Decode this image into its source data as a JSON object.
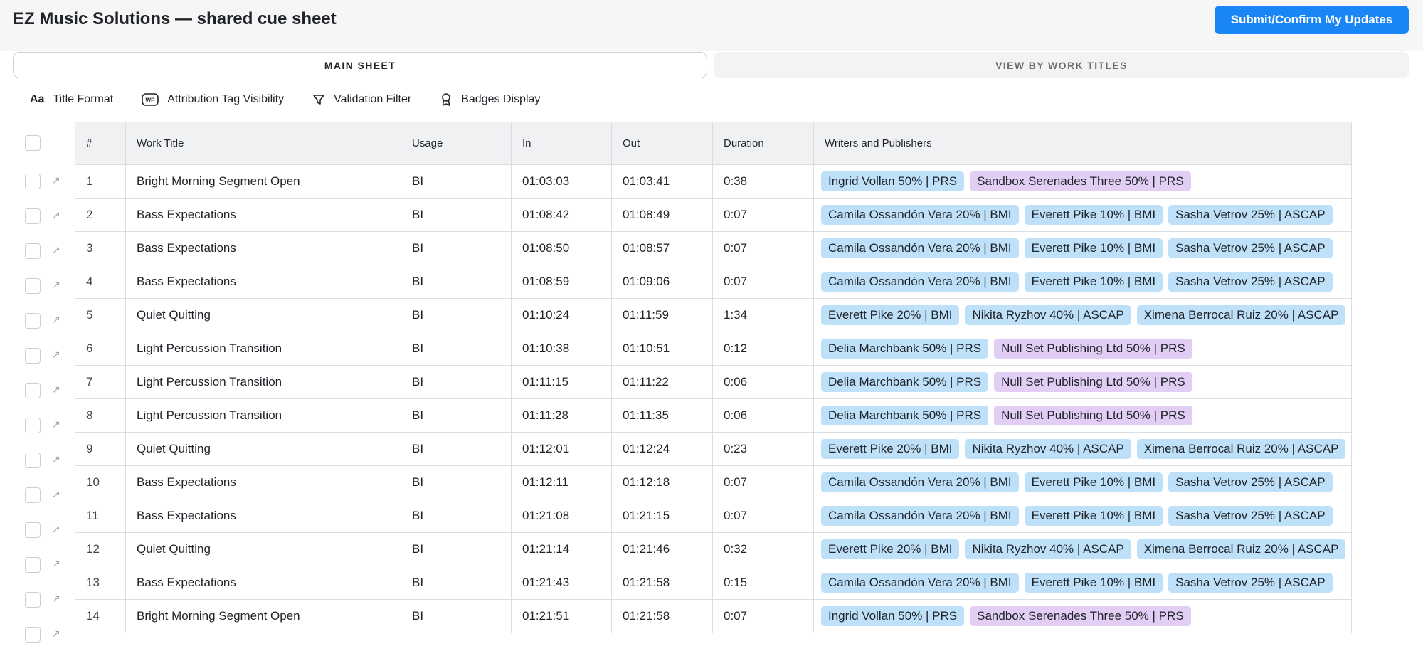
{
  "app": {
    "title": "EZ Music Solutions — shared cue sheet",
    "submit_label": "Submit/Confirm My Updates"
  },
  "tabs": {
    "main": "MAIN SHEET",
    "works": "VIEW BY WORK TITLES"
  },
  "toolbar": {
    "title_format": "Title Format",
    "attribution": "Attribution Tag Visibility",
    "validation": "Validation Filter",
    "badges": "Badges Display"
  },
  "table": {
    "headers": {
      "num": "#",
      "title": "Work Title",
      "usage": "Usage",
      "in": "In",
      "out": "Out",
      "duration": "Duration",
      "wp": "Writers and Publishers"
    },
    "rows": [
      {
        "num": "1",
        "title": "Bright Morning Segment Open",
        "usage": "BI",
        "in": "01:03:03",
        "out": "01:03:41",
        "duration": "0:38",
        "tags": [
          {
            "text": "Ingrid Vollan 50% | PRS",
            "kind": "writer"
          },
          {
            "text": "Sandbox Serenades Three 50% | PRS",
            "kind": "publisher"
          }
        ]
      },
      {
        "num": "2",
        "title": "Bass Expectations",
        "usage": "BI",
        "in": "01:08:42",
        "out": "01:08:49",
        "duration": "0:07",
        "tags": [
          {
            "text": "Camila Ossandón Vera 20% | BMI",
            "kind": "writer"
          },
          {
            "text": "Everett Pike 10% | BMI",
            "kind": "writer"
          },
          {
            "text": "Sasha Vetrov 25% | ASCAP",
            "kind": "writer"
          }
        ]
      },
      {
        "num": "3",
        "title": "Bass Expectations",
        "usage": "BI",
        "in": "01:08:50",
        "out": "01:08:57",
        "duration": "0:07",
        "tags": [
          {
            "text": "Camila Ossandón Vera 20% | BMI",
            "kind": "writer"
          },
          {
            "text": "Everett Pike 10% | BMI",
            "kind": "writer"
          },
          {
            "text": "Sasha Vetrov 25% | ASCAP",
            "kind": "writer"
          }
        ]
      },
      {
        "num": "4",
        "title": "Bass Expectations",
        "usage": "BI",
        "in": "01:08:59",
        "out": "01:09:06",
        "duration": "0:07",
        "tags": [
          {
            "text": "Camila Ossandón Vera 20% | BMI",
            "kind": "writer"
          },
          {
            "text": "Everett Pike 10% | BMI",
            "kind": "writer"
          },
          {
            "text": "Sasha Vetrov 25% | ASCAP",
            "kind": "writer"
          }
        ]
      },
      {
        "num": "5",
        "title": "Quiet Quitting",
        "usage": "BI",
        "in": "01:10:24",
        "out": "01:11:59",
        "duration": "1:34",
        "tags": [
          {
            "text": "Everett Pike 20% | BMI",
            "kind": "writer"
          },
          {
            "text": "Nikita Ryzhov 40% | ASCAP",
            "kind": "writer"
          },
          {
            "text": "Ximena Berrocal Ruiz 20% | ASCAP",
            "kind": "writer"
          }
        ]
      },
      {
        "num": "6",
        "title": "Light Percussion Transition",
        "usage": "BI",
        "in": "01:10:38",
        "out": "01:10:51",
        "duration": "0:12",
        "tags": [
          {
            "text": "Delia Marchbank 50% | PRS",
            "kind": "writer"
          },
          {
            "text": "Null Set Publishing Ltd 50% | PRS",
            "kind": "publisher"
          }
        ]
      },
      {
        "num": "7",
        "title": "Light Percussion Transition",
        "usage": "BI",
        "in": "01:11:15",
        "out": "01:11:22",
        "duration": "0:06",
        "tags": [
          {
            "text": "Delia Marchbank 50% | PRS",
            "kind": "writer"
          },
          {
            "text": "Null Set Publishing Ltd 50% | PRS",
            "kind": "publisher"
          }
        ]
      },
      {
        "num": "8",
        "title": "Light Percussion Transition",
        "usage": "BI",
        "in": "01:11:28",
        "out": "01:11:35",
        "duration": "0:06",
        "tags": [
          {
            "text": "Delia Marchbank 50% | PRS",
            "kind": "writer"
          },
          {
            "text": "Null Set Publishing Ltd 50% | PRS",
            "kind": "publisher"
          }
        ]
      },
      {
        "num": "9",
        "title": "Quiet Quitting",
        "usage": "BI",
        "in": "01:12:01",
        "out": "01:12:24",
        "duration": "0:23",
        "tags": [
          {
            "text": "Everett Pike 20% | BMI",
            "kind": "writer"
          },
          {
            "text": "Nikita Ryzhov 40% | ASCAP",
            "kind": "writer"
          },
          {
            "text": "Ximena Berrocal Ruiz 20% | ASCAP",
            "kind": "writer"
          }
        ]
      },
      {
        "num": "10",
        "title": "Bass Expectations",
        "usage": "BI",
        "in": "01:12:11",
        "out": "01:12:18",
        "duration": "0:07",
        "tags": [
          {
            "text": "Camila Ossandón Vera 20% | BMI",
            "kind": "writer"
          },
          {
            "text": "Everett Pike 10% | BMI",
            "kind": "writer"
          },
          {
            "text": "Sasha Vetrov 25% | ASCAP",
            "kind": "writer"
          }
        ]
      },
      {
        "num": "11",
        "title": "Bass Expectations",
        "usage": "BI",
        "in": "01:21:08",
        "out": "01:21:15",
        "duration": "0:07",
        "tags": [
          {
            "text": "Camila Ossandón Vera 20% | BMI",
            "kind": "writer"
          },
          {
            "text": "Everett Pike 10% | BMI",
            "kind": "writer"
          },
          {
            "text": "Sasha Vetrov 25% | ASCAP",
            "kind": "writer"
          }
        ]
      },
      {
        "num": "12",
        "title": "Quiet Quitting",
        "usage": "BI",
        "in": "01:21:14",
        "out": "01:21:46",
        "duration": "0:32",
        "tags": [
          {
            "text": "Everett Pike 20% | BMI",
            "kind": "writer"
          },
          {
            "text": "Nikita Ryzhov 40% | ASCAP",
            "kind": "writer"
          },
          {
            "text": "Ximena Berrocal Ruiz 20% | ASCAP",
            "kind": "writer"
          }
        ]
      },
      {
        "num": "13",
        "title": "Bass Expectations",
        "usage": "BI",
        "in": "01:21:43",
        "out": "01:21:58",
        "duration": "0:15",
        "tags": [
          {
            "text": "Camila Ossandón Vera 20% | BMI",
            "kind": "writer"
          },
          {
            "text": "Everett Pike 10% | BMI",
            "kind": "writer"
          },
          {
            "text": "Sasha Vetrov 25% | ASCAP",
            "kind": "writer"
          }
        ]
      },
      {
        "num": "14",
        "title": "Bright Morning Segment Open",
        "usage": "BI",
        "in": "01:21:51",
        "out": "01:21:58",
        "duration": "0:07",
        "tags": [
          {
            "text": "Ingrid Vollan 50% | PRS",
            "kind": "writer"
          },
          {
            "text": "Sandbox Serenades Three 50% | PRS",
            "kind": "publisher"
          }
        ]
      }
    ]
  }
}
